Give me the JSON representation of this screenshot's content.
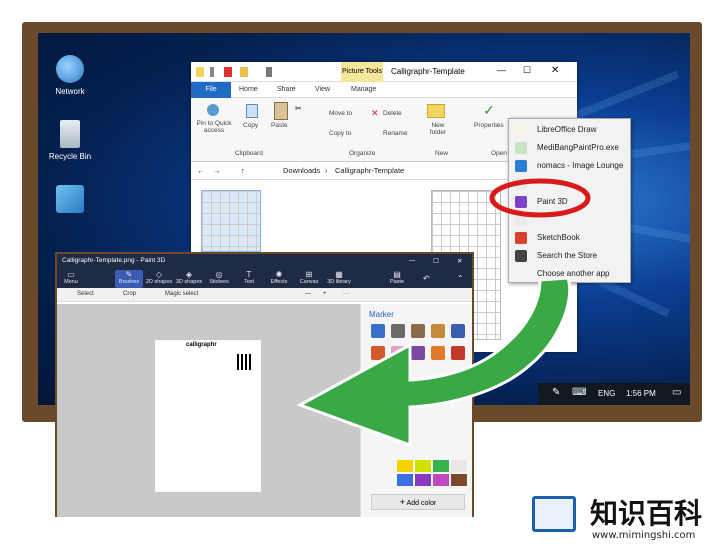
{
  "desktop": {
    "icons": [
      {
        "label": "Network",
        "icon": "network-globe-icon"
      },
      {
        "label": "Recycle Bin",
        "icon": "recycle-bin-icon"
      },
      {
        "label": "",
        "icon": "control-panel-icon"
      }
    ]
  },
  "explorer": {
    "context_tab": "Picture Tools",
    "title": "Calligraphr-Template",
    "tabs": [
      "File",
      "Home",
      "Share",
      "View",
      "Manage"
    ],
    "ribbon": {
      "pin_label": "Pin to Quick access",
      "copy_label": "Copy",
      "paste_label": "Paste",
      "clipboard_group": "Clipboard",
      "move_to": "Move to",
      "copy_to": "Copy to",
      "delete": "Delete",
      "rename": "Rename",
      "organize_group": "Organize",
      "new_folder": "New folder",
      "new_group": "New",
      "properties": "Properties",
      "open_group": "Open"
    },
    "address": [
      "Downloads",
      "Calligraphr-Template"
    ]
  },
  "context_menu": {
    "items": [
      {
        "label": "LibreOffice Draw",
        "color": "#f6f3e4"
      },
      {
        "label": "MediBangPaintPro.exe",
        "color": "#c7e3c3"
      },
      {
        "label": "nomacs - Image Lounge",
        "color": "#2b7dd1"
      },
      {
        "label": "",
        "color": "#eaeaea"
      },
      {
        "label": "Paint 3D",
        "color": "#7a43c9"
      },
      {
        "label": "",
        "color": "#eaeaea"
      },
      {
        "label": "SketchBook",
        "color": "#d6402c"
      },
      {
        "label": "Search the Store",
        "color": "#444444"
      },
      {
        "label": "Choose another app",
        "color": "#f2f2f2"
      }
    ],
    "highlight_color": "#d71a1a"
  },
  "taskbar": {
    "lang": "ENG",
    "time": "1:56 PM"
  },
  "paint3d": {
    "title": "Calligraphr-Template.png - Paint 3D",
    "menu_label": "Menu",
    "toolbar": [
      "Brushes",
      "2D shapes",
      "3D shapes",
      "Stickers",
      "Text",
      "Effects",
      "Canvas",
      "3D library"
    ],
    "paste_label": "Paste",
    "subbar": [
      "Select",
      "Crop",
      "Magic select"
    ],
    "panel_title": "Marker",
    "add_color": "Add color",
    "page_heading": "calligraphr"
  },
  "arrow_color": "#3aa844",
  "watermark": {
    "text": "知识百科",
    "url": "www.mimingshi.com"
  }
}
